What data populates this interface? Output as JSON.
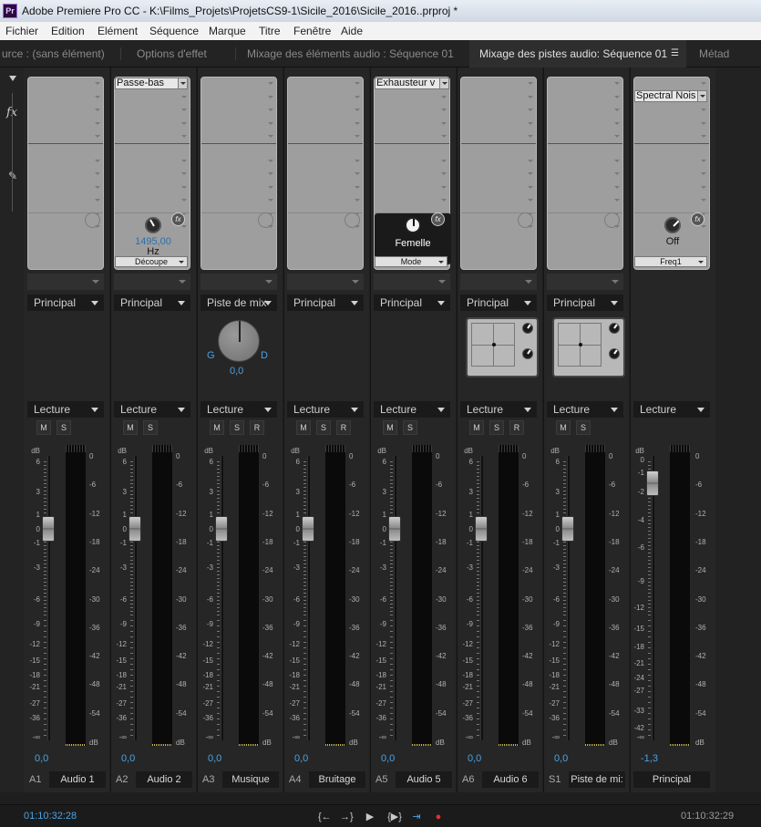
{
  "window": {
    "title": "Adobe Premiere Pro CC - K:\\Films_Projets\\ProjetsCS9-1\\Sicile_2016\\Sicile_2016..prproj *",
    "logo": "Pr"
  },
  "menu": [
    "Fichier",
    "Edition",
    "Elément",
    "Séquence",
    "Marque",
    "Titre",
    "Fenêtre",
    "Aide"
  ],
  "tabs": [
    {
      "label": "urce : (sans élément)"
    },
    {
      "label": "Options d'effet"
    },
    {
      "label": "Mixage des éléments audio : Séquence 01"
    },
    {
      "label": "Mixage des pistes audio: Séquence 01",
      "active": true,
      "menu_icon": "☰"
    },
    {
      "label": "Métad"
    }
  ],
  "sidebar": {
    "collapse_icon": "triangle-down-icon",
    "fx_label": "fx",
    "send_icon": "pen-icon"
  },
  "strips": [
    {
      "effect": "",
      "param_value": "",
      "param_unit": "",
      "param_mode": "",
      "bus": "Principal",
      "mode": "Lecture",
      "buttons": [
        "M",
        "S"
      ],
      "value": "0,0",
      "code": "A1",
      "name": "Audio 1"
    },
    {
      "effect": "Passe-bas",
      "param_value": "1495,00",
      "param_unit": "Hz",
      "param_mode": "Découpe",
      "bus": "Principal",
      "mode": "Lecture",
      "buttons": [
        "M",
        "S"
      ],
      "value": "0,0",
      "code": "A2",
      "name": "Audio 2"
    },
    {
      "effect": "",
      "param_value": "",
      "param_unit": "",
      "param_mode": "",
      "bus": "Piste de mix",
      "mode": "Lecture",
      "buttons": [
        "M",
        "S",
        "R"
      ],
      "value": "0,0",
      "code": "A3",
      "name": "Musique",
      "pan": {
        "left": "G",
        "right": "D",
        "value": "0,0"
      }
    },
    {
      "effect": "",
      "param_value": "",
      "param_unit": "",
      "param_mode": "",
      "bus": "Principal",
      "mode": "Lecture",
      "buttons": [
        "M",
        "S",
        "R"
      ],
      "value": "0,0",
      "code": "A4",
      "name": "Bruitage"
    },
    {
      "effect": "Exhausteur v",
      "param_value": "Femelle",
      "param_unit": "",
      "param_mode": "Mode",
      "bus": "Principal",
      "mode": "Lecture",
      "buttons": [
        "M",
        "S"
      ],
      "value": "0,0",
      "code": "A5",
      "name": "Audio 5"
    },
    {
      "effect": "",
      "param_value": "",
      "param_unit": "",
      "param_mode": "",
      "bus": "Principal",
      "mode": "Lecture",
      "buttons": [
        "M",
        "S",
        "R"
      ],
      "value": "0,0",
      "code": "A6",
      "name": "Audio 6",
      "panner": true
    },
    {
      "effect": "",
      "param_value": "",
      "param_unit": "",
      "param_mode": "",
      "bus": "Principal",
      "mode": "Lecture",
      "buttons": [
        "M",
        "S"
      ],
      "value": "0,0",
      "code": "S1",
      "name": "Piste de mi:",
      "panner": true
    },
    {
      "effect": "Spectral Nois",
      "param_value": "Off",
      "param_unit": "",
      "param_mode": "Freq1",
      "bus": "",
      "mode": "Lecture",
      "buttons": [],
      "value": "-1,3",
      "code": "",
      "name": "Principal",
      "master": true
    }
  ],
  "scale_left": [
    "dB",
    "6",
    "3",
    "1",
    "0",
    "-1",
    "-3",
    "-6",
    "-9",
    "-12",
    "-15",
    "-18",
    "-21",
    "-27",
    "-36",
    "-∞"
  ],
  "scale_right": [
    "0",
    "-6",
    "-12",
    "-18",
    "-24",
    "-30",
    "-36",
    "-42",
    "-48",
    "-54",
    "dB"
  ],
  "master_scale_left": [
    "dB",
    "0",
    "-1",
    "-2",
    "-4",
    "-6",
    "-9",
    "-12",
    "-15",
    "-18",
    "-21",
    "-24",
    "-27",
    "-33",
    "-42",
    "-∞"
  ],
  "transport": {
    "timecode_left": "01:10:32:28",
    "timecode_right": "01:10:32:29",
    "controls": [
      "{←",
      "→}",
      "▶",
      "{▶}",
      "⇥",
      "●"
    ]
  },
  "colors": {
    "accent": "#49a3e6",
    "record": "#e03030"
  }
}
